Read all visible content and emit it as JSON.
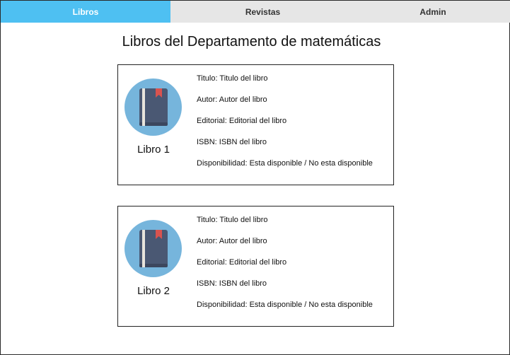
{
  "tabs": [
    {
      "label": "Libros",
      "active": true
    },
    {
      "label": "Revistas",
      "active": false
    },
    {
      "label": "Admin",
      "active": false
    }
  ],
  "page": {
    "title": "Libros del Departamento de matemáticas"
  },
  "colors": {
    "active_tab": "#4ec0f2",
    "inactive_tab": "#e6e6e6",
    "avatar_bg": "#76b5dc",
    "book_cover": "#4a5873",
    "bookmark": "#d9534f"
  },
  "books": [
    {
      "name": "Libro 1",
      "icon": "book-icon",
      "fields": [
        "Titulo: Titulo del libro",
        "Autor: Autor del libro",
        "Editorial: Editorial del libro",
        "ISBN: ISBN del libro",
        "Disponibilidad: Esta disponible / No esta disponible"
      ]
    },
    {
      "name": "Libro 2",
      "icon": "book-icon",
      "fields": [
        "Titulo: Titulo del libro",
        "Autor: Autor del libro",
        "Editorial: Editorial del libro",
        "ISBN: ISBN del libro",
        "Disponibilidad: Esta disponible / No esta disponible"
      ]
    }
  ]
}
